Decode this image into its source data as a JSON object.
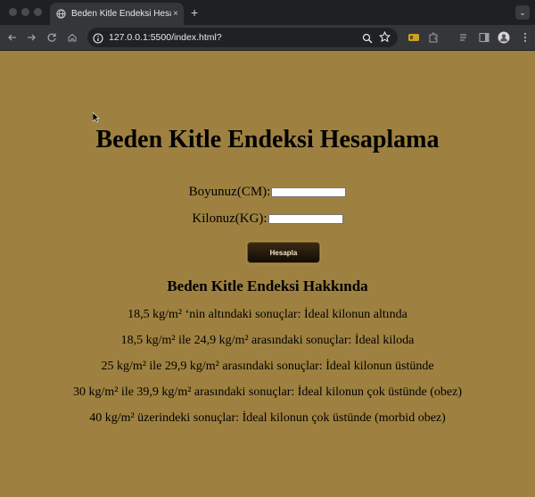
{
  "browser": {
    "tab_title": "Beden Kitle Endeksi Hesaplam",
    "tab_close": "×",
    "new_tab": "+",
    "url": "127.0.0.1:5500/index.html?"
  },
  "page": {
    "title": "Beden Kitle Endeksi Hesaplama",
    "height_label": "Boyunuz(CM):",
    "height_value": "",
    "weight_label": "Kilonuz(KG):",
    "weight_value": "",
    "calc_button": "Hesapla",
    "about_title": "Beden Kitle Endeksi Hakkında",
    "info": [
      "18,5 kg/m² ‘nin altındaki sonuçlar: İdeal kilonun altında",
      "18,5 kg/m² ile 24,9 kg/m² arasındaki sonuçlar: İdeal kiloda",
      "25 kg/m² ile 29,9 kg/m² arasındaki sonuçlar: İdeal kilonun üstünde",
      "30 kg/m² ile 39,9 kg/m² arasındaki sonuçlar: İdeal kilonun çok üstünde (obez)",
      "40 kg/m² üzerindeki sonuçlar: İdeal kilonun çok üstünde (morbid obez)"
    ]
  },
  "colors": {
    "page_background": "#9e8140",
    "button_background": "#1a1208",
    "button_text": "#f2e3c3"
  }
}
